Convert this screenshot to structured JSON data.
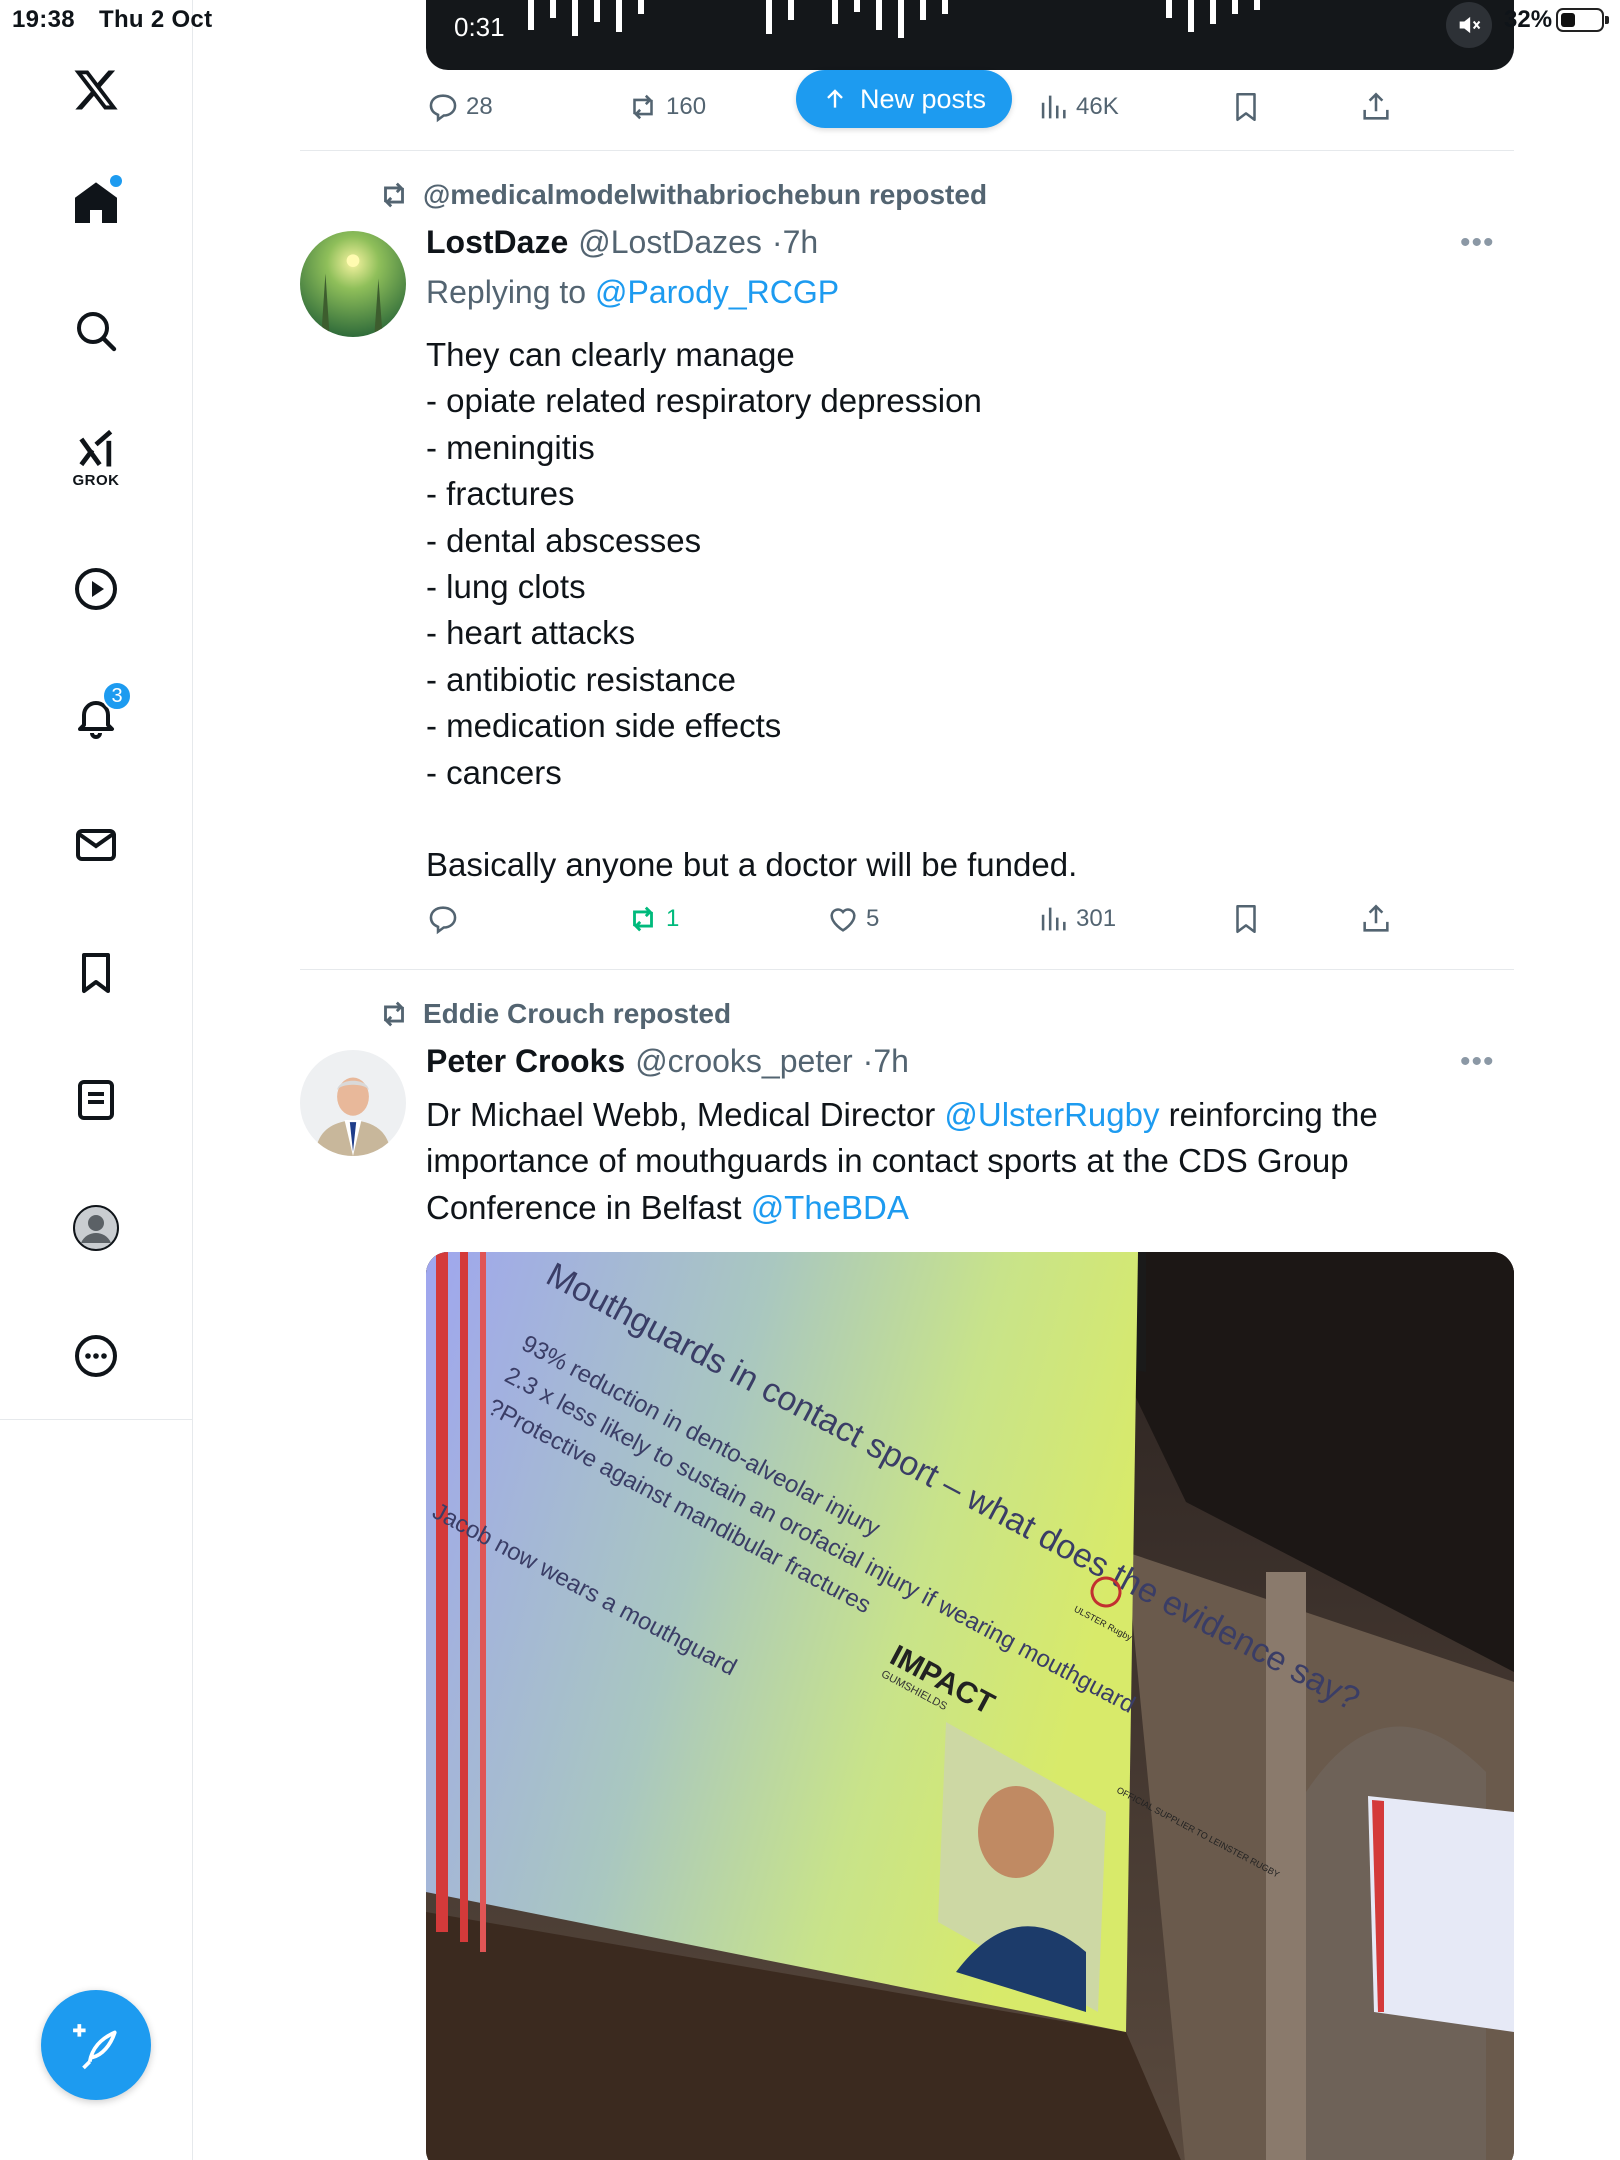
{
  "status_bar": {
    "time": "19:38",
    "date": "Thu 2 Oct",
    "battery": "32%"
  },
  "sidebar": {
    "items": [
      {
        "name": "home",
        "icon": "home-icon",
        "badge": "dot"
      },
      {
        "name": "explore",
        "icon": "search-icon"
      },
      {
        "name": "grok",
        "icon": "grok-icon",
        "label": "GROK"
      },
      {
        "name": "video",
        "icon": "play-icon"
      },
      {
        "name": "notifications",
        "icon": "bell-icon",
        "badge": "3"
      },
      {
        "name": "messages",
        "icon": "mail-icon"
      },
      {
        "name": "bookmarks",
        "icon": "bookmark-icon"
      },
      {
        "name": "lists",
        "icon": "list-icon"
      },
      {
        "name": "profile",
        "icon": "profile-icon"
      },
      {
        "name": "more",
        "icon": "more-icon"
      }
    ],
    "compose_icon": "compose-icon"
  },
  "timeline": {
    "new_posts_label": "New posts",
    "top_post": {
      "media_time": "0:31",
      "replies": "28",
      "reposts": "160",
      "views": "46K"
    },
    "posts": [
      {
        "repost_label": "@medicalmodelwithabriochebun reposted",
        "name": "LostDaze",
        "handle": "@LostDazes",
        "time": "7h",
        "reply_prefix": "Replying to",
        "reply_to": "@Parody_RCGP",
        "body": "They can clearly manage\n- opiate related respiratory depression\n- meningitis\n- fractures\n- dental abscesses\n- lung clots\n- heart attacks\n- antibiotic resistance\n- medication side effects\n- cancers\n\nBasically anyone but a doctor will be funded.",
        "replies": "",
        "reposts": "1",
        "likes": "5",
        "views": "301"
      },
      {
        "repost_label": "Eddie Crouch reposted",
        "name": "Peter Crooks",
        "handle": "@crooks_peter",
        "time": "7h",
        "body_part1": "Dr Michael Webb, Medical Director ",
        "mention1": "@UlsterRugby",
        "body_part2": " reinforcing the importance of mouthguards in contact sports at the CDS Group Conference in Belfast ",
        "mention2": "@TheBDA",
        "slide": {
          "title": "Mouthguards in contact sport – what does the evidence say?",
          "bullets": [
            "93% reduction in dento-alveolar injury",
            "2.3 x less likely to sustain an orofacial injury if wearing mouthguard",
            "?Protective against mandibular fractures"
          ],
          "last_bullet": "Jacob now wears a mouthguard",
          "brand": "IMPACT",
          "brand_sub": "GUMSHIELDS",
          "supplier": "OFFICIAL SUPPLIER TO LEINSTER RUGBY",
          "crest": "ULSTER Rugby"
        }
      }
    ]
  },
  "colors": {
    "accent": "#1d9bf0",
    "muted": "#536471",
    "repost_green": "#00ba7c"
  }
}
